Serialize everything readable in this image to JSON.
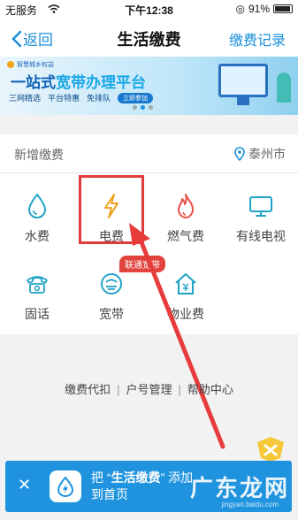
{
  "status_bar": {
    "carrier": "无服务",
    "time": "下午12:38",
    "battery": "91%"
  },
  "nav": {
    "back_label": "返回",
    "title": "生活缴费",
    "records_label": "缴费记录"
  },
  "banner": {
    "brand": "智慧城乡权益",
    "headline_prefix": "一站式",
    "headline_highlight": "宽带办理平台",
    "features": [
      "三网精选",
      "平台特惠",
      "免排队"
    ],
    "cta": "立即参加"
  },
  "section": {
    "label": "新增缴费",
    "city": "泰州市"
  },
  "services": [
    {
      "label": "水费",
      "icon": "water-drop-icon"
    },
    {
      "label": "电费",
      "icon": "lightning-icon"
    },
    {
      "label": "燃气费",
      "icon": "flame-icon"
    },
    {
      "label": "有线电视",
      "icon": "tv-icon"
    },
    {
      "label": "固话",
      "icon": "telephone-icon"
    },
    {
      "label": "宽带",
      "icon": "broadband-icon"
    },
    {
      "label": "物业费",
      "icon": "property-icon"
    }
  ],
  "badge": "联通宽带",
  "links": [
    "缴费代扣",
    "户号管理",
    "帮助中心"
  ],
  "bottom_bar": {
    "close": "✕",
    "text_prefix": "把 “",
    "text_app": "生活缴费",
    "text_suffix": "” 添加",
    "text_line2": "到首页"
  },
  "watermark": {
    "logo_text": "广东龙网",
    "url": "jingyan.baidu.com"
  },
  "colors": {
    "accent": "#1a8fd8",
    "highlight_red": "#e03a3a",
    "bolt": "#f0a020",
    "flame": "#e8504a"
  }
}
